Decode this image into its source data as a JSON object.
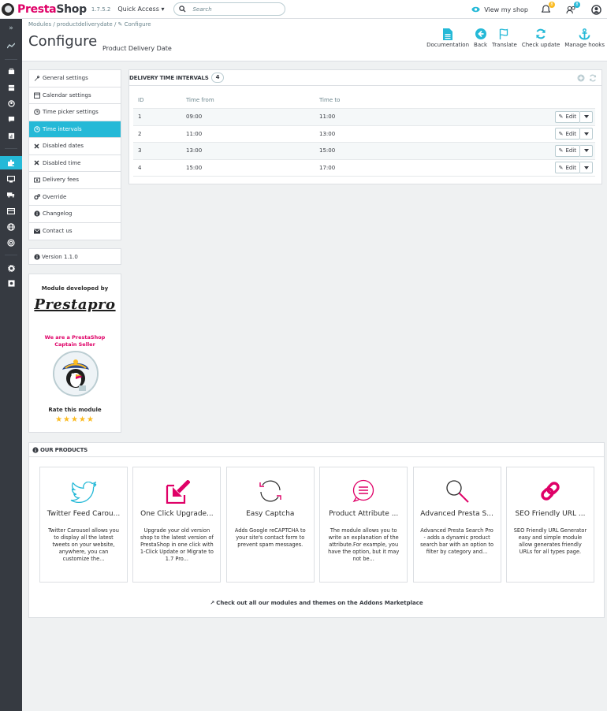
{
  "topbar": {
    "brand_pre": "Presta",
    "brand_post": "Shop",
    "version": "1.7.5.2",
    "quick_access": "Quick Access ▾",
    "search_placeholder": "Search",
    "view_shop": "View my shop",
    "notifications": [
      {
        "count": "8"
      },
      {
        "count": "8"
      }
    ]
  },
  "header": {
    "breadcrumb": "Modules  /  productdeliverydate  /  ✎ Configure",
    "title": "Configure",
    "subtitle": "Product Delivery Date",
    "toolbar": [
      "Documentation",
      "Back",
      "Translate",
      "Check update",
      "Manage hooks"
    ]
  },
  "menu": {
    "items": [
      {
        "label": "General settings",
        "icon": "wrench-icon"
      },
      {
        "label": "Calendar settings",
        "icon": "calendar-icon"
      },
      {
        "label": "Time picker settings",
        "icon": "clock-icon"
      },
      {
        "label": "Time intervals",
        "icon": "clock-icon",
        "active": true
      },
      {
        "label": "Disabled dates",
        "icon": "x-icon"
      },
      {
        "label": "Disabled time",
        "icon": "x-icon"
      },
      {
        "label": "Delivery fees",
        "icon": "money-icon"
      },
      {
        "label": "Override",
        "icon": "cogs-icon"
      },
      {
        "label": "Changelog",
        "icon": "info-icon"
      },
      {
        "label": "Contact us",
        "icon": "envelope-icon"
      }
    ],
    "version": "Version 1.1.0"
  },
  "developer": {
    "developed_by": "Module developed by",
    "brand": "Prestapro",
    "captain_line1": "We are a PrestaShop",
    "captain_line2": "Captain Seller",
    "rate": "Rate this module",
    "stars": "★★★★★"
  },
  "intervals": {
    "heading": "DELIVERY TIME INTERVALS",
    "count": "4",
    "columns": [
      "ID",
      "Time from",
      "Time to"
    ],
    "rows": [
      {
        "id": "1",
        "from": "09:00",
        "to": "11:00"
      },
      {
        "id": "2",
        "from": "11:00",
        "to": "13:00"
      },
      {
        "id": "3",
        "from": "13:00",
        "to": "15:00"
      },
      {
        "id": "4",
        "from": "15:00",
        "to": "17:00"
      }
    ],
    "edit_label": "Edit"
  },
  "products": {
    "heading": "OUR PRODUCTS",
    "cards": [
      {
        "title": "Twitter Feed Carou...",
        "desc": "Twitter Carousel allows you to display all the latest tweets on your website, anywhere, you can customize the...",
        "icon": "twitter-icon",
        "color": "#25b9d7"
      },
      {
        "title": "One Click Upgrade...",
        "desc": "Upgrade your old version shop to the latest version of PrestaShop in one click with 1-Click Update or Migrate to 1.7 Pro...",
        "icon": "upgrade-icon",
        "color": "#df0067"
      },
      {
        "title": "Easy Captcha",
        "desc": "Adds Google reCAPTCHA to your site's contact form to prevent spam messages.",
        "icon": "refresh-icon",
        "color": "#df0067"
      },
      {
        "title": "Product Attribute ...",
        "desc": "The module allows you to write an explanation of the attribute.For example, you have the option, but it may not be...",
        "icon": "comment-icon",
        "color": "#df0067"
      },
      {
        "title": "Advanced Presta S...",
        "desc": "Advanced Presta Search Pro - adds a dynamic product search bar with an option to filter by category and...",
        "icon": "magnifier-icon",
        "color": "#df0067"
      },
      {
        "title": "SEO Friendly URL ...",
        "desc": "SEO Friendly URL Generator easy and simple module allow generates friendly URLs for all types page.",
        "icon": "link-icon",
        "color": "#df0067"
      }
    ],
    "market_link": "Check out all our modules and themes on the Addons Marketplace"
  }
}
